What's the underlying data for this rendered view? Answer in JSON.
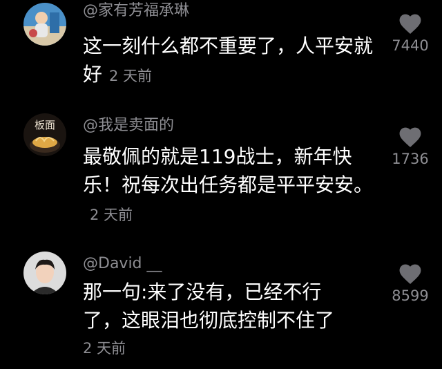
{
  "comments": [
    {
      "username": "@家有芳福承琳",
      "text": "这一刻什么都不重要了，人平安就好",
      "time": "2 天前",
      "likes": "7440",
      "avatar_icon": "avatar-child-photo"
    },
    {
      "username": "@我是卖面的",
      "text": "最敬佩的就是119战士，新年快乐！祝每次出任务都是平平安安。",
      "time": "2 天前",
      "likes": "1736",
      "avatar_icon": "avatar-noodle-bowl",
      "avatar_text": "板面"
    },
    {
      "username": "@David __",
      "text": "那一句:来了没有，已经不行了，这眼泪也彻底控制不住了",
      "time": "2 天前",
      "likes": "8599",
      "avatar_icon": "avatar-man-portrait"
    }
  ],
  "colors": {
    "background": "#000000",
    "primary_text": "#ffffff",
    "secondary_text": "#8e8e93",
    "heart": "#6e6e73"
  },
  "icons": {
    "like": "heart-icon"
  }
}
